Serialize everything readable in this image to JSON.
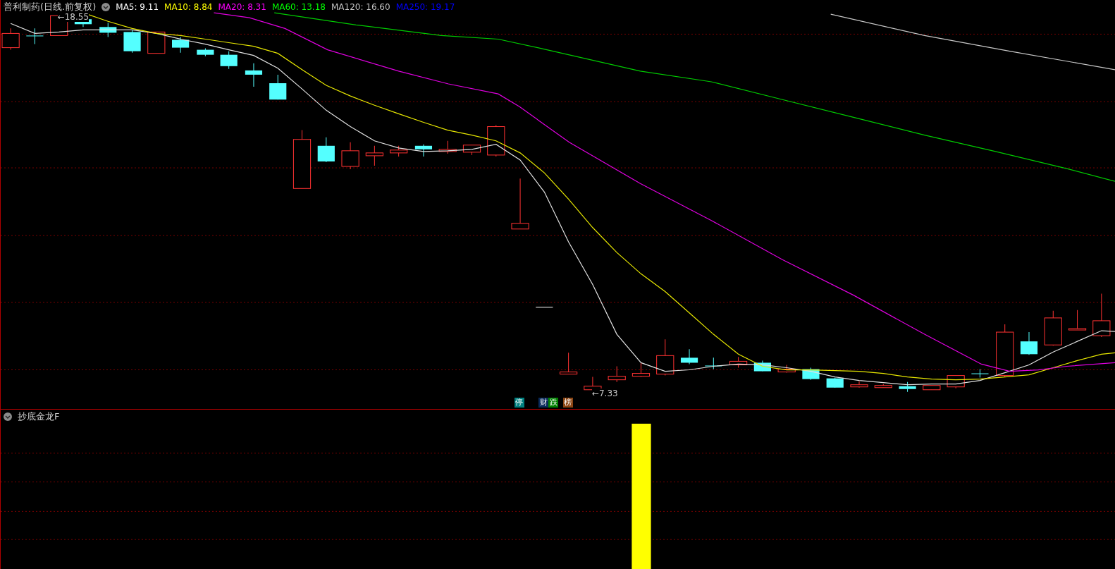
{
  "main_panel": {
    "title": "普利制药(日线.前复权)",
    "ma_legend": [
      {
        "label": "MA5: 9.11",
        "color": "#ffffff"
      },
      {
        "label": "MA10: 8.84",
        "color": "#ffff00"
      },
      {
        "label": "MA20: 8.31",
        "color": "#ff00ff"
      },
      {
        "label": "MA60: 13.18",
        "color": "#00ff00"
      },
      {
        "label": "MA120: 16.60",
        "color": "#c0c0c0"
      },
      {
        "label": "MA250: 19.17",
        "color": "#0000ff"
      }
    ],
    "price_labels": [
      {
        "kind": "high",
        "text": "←18.55"
      },
      {
        "kind": "low",
        "text": "←7.33"
      }
    ],
    "event_markers": [
      {
        "text": "停",
        "color": "#008080"
      },
      {
        "text": "财",
        "color": "#0a2a5a"
      },
      {
        "text": "跌",
        "color": "#008000"
      },
      {
        "text": "榜",
        "color": "#8b4513"
      }
    ]
  },
  "indicator_panel": {
    "title": "抄底金龙F"
  }
}
